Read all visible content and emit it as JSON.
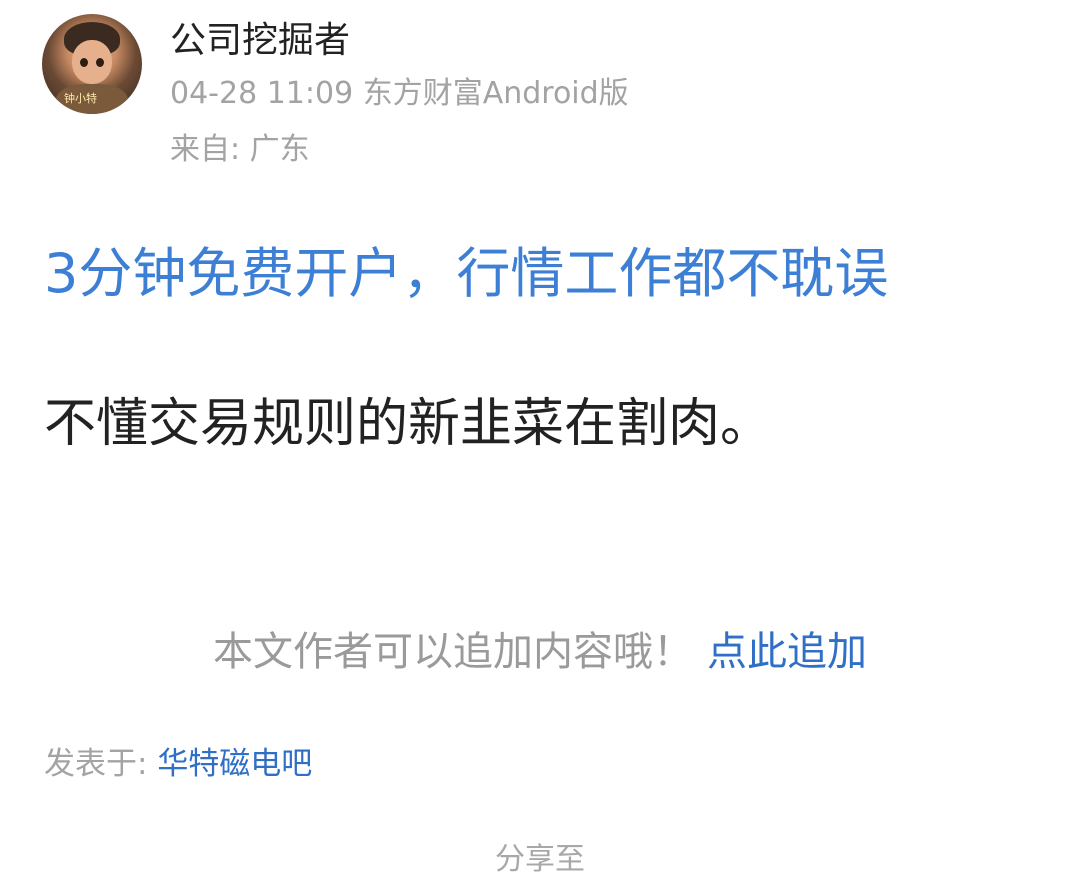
{
  "post": {
    "author": {
      "name": "公司挖掘者",
      "avatar_tag": "钟小特"
    },
    "time_client": "04-28 11:09 东方财富Android版",
    "location": "来自: 广东",
    "promo_link": "3分钟免费开户，行情工作都不耽误",
    "body": "不懂交易规则的新韭菜在割肉。"
  },
  "append": {
    "hint": "本文作者可以追加内容哦！",
    "link": "点此追加"
  },
  "posted_in": {
    "label": "发表于: ",
    "bar": "华特磁电吧"
  },
  "share": {
    "label": "分享至"
  },
  "colors": {
    "link_blue": "#3d7fd4",
    "secondary_gray": "#a3a3a3",
    "text_dark": "#222222"
  }
}
